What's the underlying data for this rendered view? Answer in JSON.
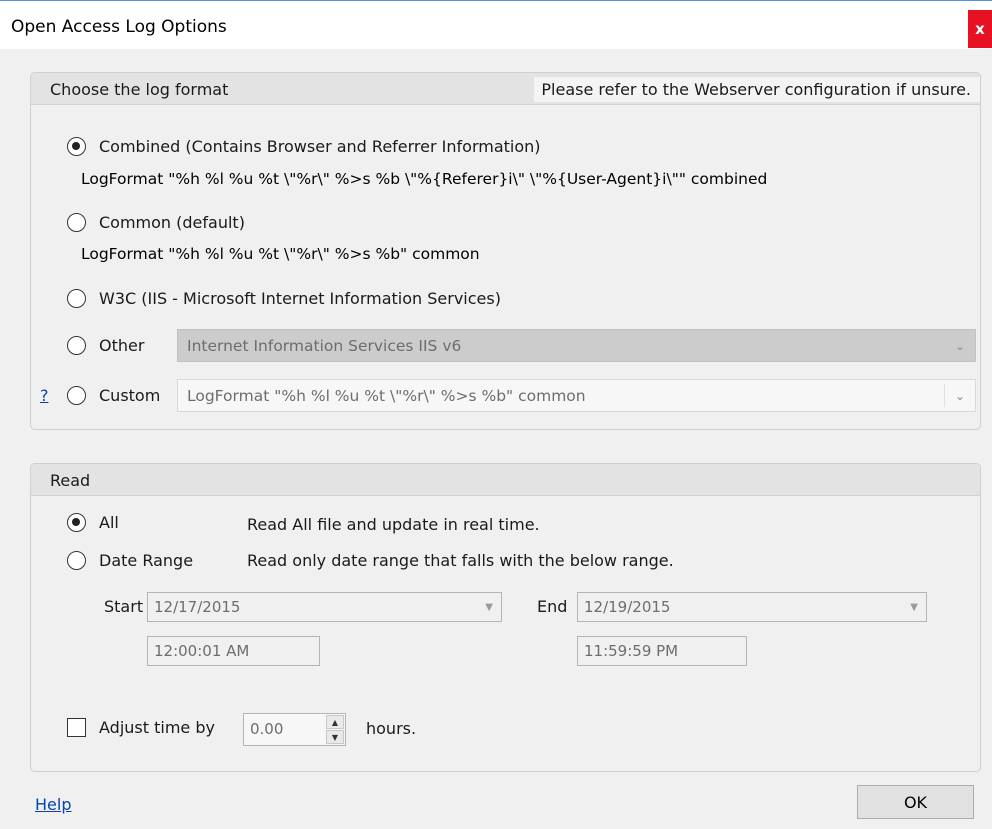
{
  "window": {
    "title": "Open Access Log Options",
    "close_glyph": "x"
  },
  "log_format": {
    "header": "Choose the log format",
    "hint": "Please refer to the Webserver configuration if unsure.",
    "options": {
      "combined": {
        "label": "Combined (Contains Browser and Referrer Information)",
        "checked": true,
        "format": "LogFormat \"%h %l %u %t \\\"%r\\\" %>s %b \\\"%{Referer}i\\\" \\\"%{User-Agent}i\\\"\" combined"
      },
      "common": {
        "label": "Common (default)",
        "checked": false,
        "format": "LogFormat \"%h %l %u %t \\\"%r\\\" %>s %b\" common"
      },
      "w3c": {
        "label": "W3C (IIS - Microsoft Internet Information Services)",
        "checked": false
      },
      "other": {
        "label": "Other",
        "checked": false,
        "select_value": "Internet Information Services IIS v6"
      },
      "custom": {
        "label": "Custom",
        "checked": false,
        "help_link": "?",
        "select_value": "LogFormat \"%h %l %u %t \\\"%r\\\" %>s %b\" common"
      }
    }
  },
  "read": {
    "header": "Read",
    "all": {
      "label": "All",
      "checked": true,
      "description": "Read All file and update in real time."
    },
    "date_range": {
      "label": "Date Range",
      "checked": false,
      "description": "Read only date range that falls with the below range."
    },
    "start": {
      "label": "Start",
      "date": "12/17/2015",
      "time": "12:00:01 AM"
    },
    "end": {
      "label": "End",
      "date": "12/19/2015",
      "time": "11:59:59 PM"
    },
    "adjust": {
      "label": "Adjust time by",
      "checked": false,
      "value": "0.00",
      "unit": "hours."
    }
  },
  "footer": {
    "help": "Help",
    "ok": "OK"
  },
  "icons": {
    "dropdown": "chevron-down-icon",
    "spin_up": "caret-up-icon",
    "spin_down": "caret-down-icon"
  }
}
